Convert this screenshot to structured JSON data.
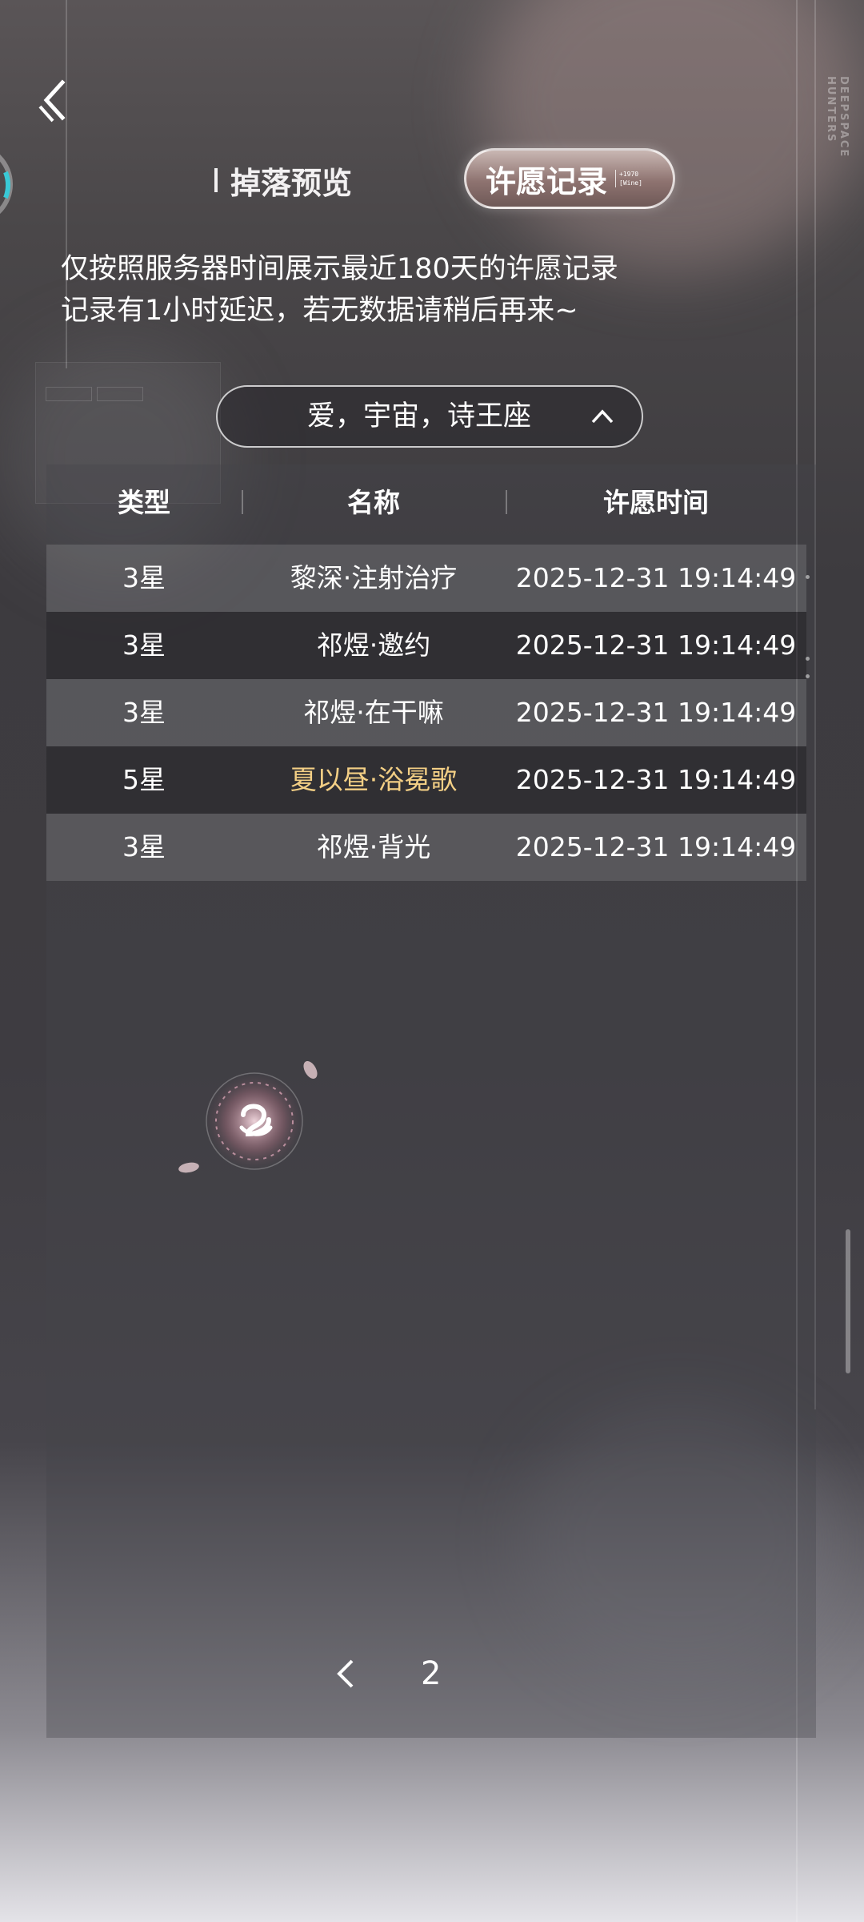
{
  "brand": {
    "line1": "DEEPSPACE",
    "line2": "HUNTERS"
  },
  "tabs": {
    "preview_label": "掉落预览",
    "record_label": "许愿记录",
    "record_badge_line1": "+1970",
    "record_badge_line2": "[Wine]"
  },
  "notice": {
    "line1": "仅按照服务器时间展示最近180天的许愿记录",
    "line2": "记录有1小时延迟，若无数据请稍后再来~"
  },
  "pool_selector": {
    "selected": "爱，宇宙，诗王座"
  },
  "table": {
    "headers": {
      "type": "类型",
      "name": "名称",
      "time": "许愿时间"
    },
    "rows": [
      {
        "type": "3星",
        "name": "黎深·注射治疗",
        "time": "2025-12-31 19:14:49"
      },
      {
        "type": "3星",
        "name": "祁煜·邀约",
        "time": "2025-12-31 19:14:49"
      },
      {
        "type": "3星",
        "name": "祁煜·在干嘛",
        "time": "2025-12-31 19:14:49"
      },
      {
        "type": "5星",
        "name": "夏以昼·浴冕歌",
        "time": "2025-12-31 19:14:49"
      },
      {
        "type": "3星",
        "name": "祁煜·背光",
        "time": "2025-12-31 19:14:49"
      }
    ]
  },
  "pagination": {
    "current_page": "2"
  },
  "colors": {
    "five_star_name": "#f3cf85",
    "text": "#ffffff",
    "accent_ring": "#39c9d6"
  },
  "icons": {
    "back": "back-icon",
    "chevron_up": "chevron-up-icon",
    "prev_page": "chevron-left-icon",
    "emblem": "emblem-icon"
  }
}
